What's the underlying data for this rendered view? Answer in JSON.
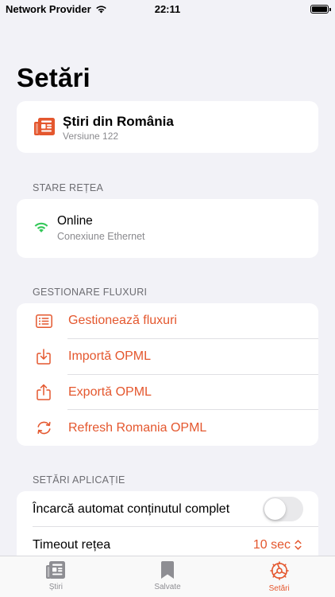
{
  "status_bar": {
    "carrier": "Network Provider",
    "time": "22:11"
  },
  "page_title": "Setări",
  "app": {
    "name": "Știri din România",
    "version": "Versiune 122",
    "icon": "newspaper-icon"
  },
  "network": {
    "header": "STARE REȚEA",
    "status": "Online",
    "detail": "Conexiune Ethernet",
    "icon": "wifi-icon",
    "status_color": "#34c759"
  },
  "feeds": {
    "header": "GESTIONARE FLUXURI",
    "items": [
      {
        "label": "Gestionează fluxuri",
        "icon": "list-icon"
      },
      {
        "label": "Importă OPML",
        "icon": "import-icon"
      },
      {
        "label": "Exportă OPML",
        "icon": "export-icon"
      },
      {
        "label": "Refresh Romania OPML",
        "icon": "refresh-icon"
      }
    ]
  },
  "app_settings": {
    "header": "SETĂRI APLICAȚIE",
    "autoload_label": "Încarcă automat conținutul complet",
    "autoload_enabled": false,
    "timeout_label": "Timeout rețea",
    "timeout_value": "10 sec"
  },
  "tab_bar": {
    "tabs": [
      {
        "label": "Știri",
        "icon": "news-tab-icon",
        "active": false
      },
      {
        "label": "Salvate",
        "icon": "bookmark-icon",
        "active": false
      },
      {
        "label": "Setări",
        "icon": "settings-gear-icon",
        "active": true
      }
    ]
  },
  "colors": {
    "accent": "#e4572e",
    "background": "#f2f2f7",
    "online": "#34c759"
  }
}
